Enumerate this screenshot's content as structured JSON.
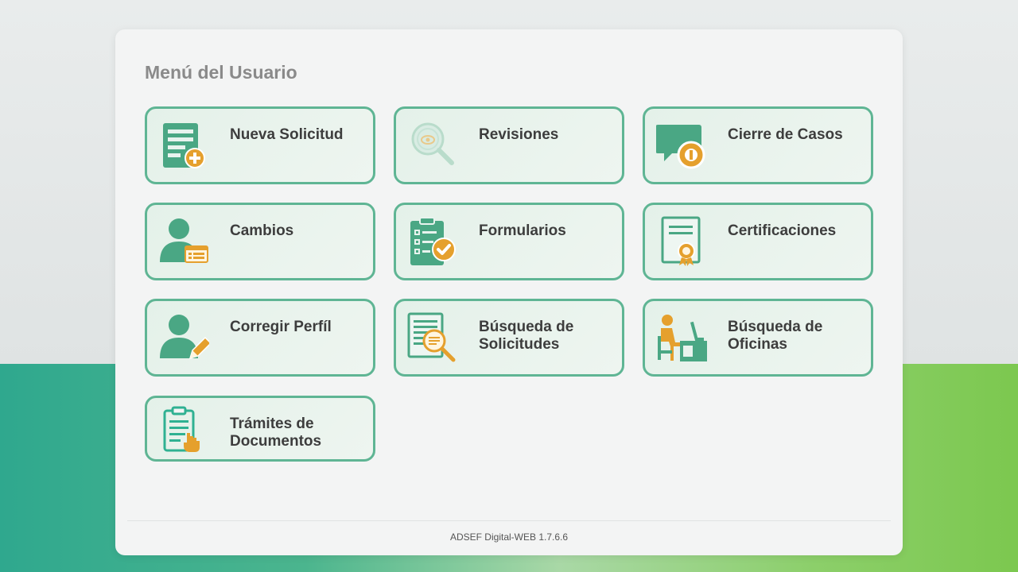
{
  "panel": {
    "title": "Menú del Usuario"
  },
  "menu": {
    "items": [
      {
        "label": "Nueva Solicitud",
        "icon": "new-request-icon"
      },
      {
        "label": "Revisiones",
        "icon": "review-magnifier-icon"
      },
      {
        "label": "Cierre de Casos",
        "icon": "case-closure-icon"
      },
      {
        "label": "Cambios",
        "icon": "user-changes-icon"
      },
      {
        "label": "Formularios",
        "icon": "forms-clipboard-icon"
      },
      {
        "label": "Certificaciones",
        "icon": "certificate-icon"
      },
      {
        "label": "Corregir Perfíl",
        "icon": "edit-profile-icon"
      },
      {
        "label": "Búsqueda de Solicitudes",
        "icon": "search-documents-icon"
      },
      {
        "label": "Búsqueda de Oficinas",
        "icon": "office-desk-icon"
      },
      {
        "label": "Trámites de Documentos",
        "icon": "document-process-icon"
      }
    ]
  },
  "footer": {
    "version": "ADSEF Digital-WEB 1.7.6.6"
  },
  "colors": {
    "card_border": "#5fb594",
    "icon_green": "#4aa784",
    "icon_orange": "#e5a02d",
    "title_gray": "#8a8a8a"
  }
}
